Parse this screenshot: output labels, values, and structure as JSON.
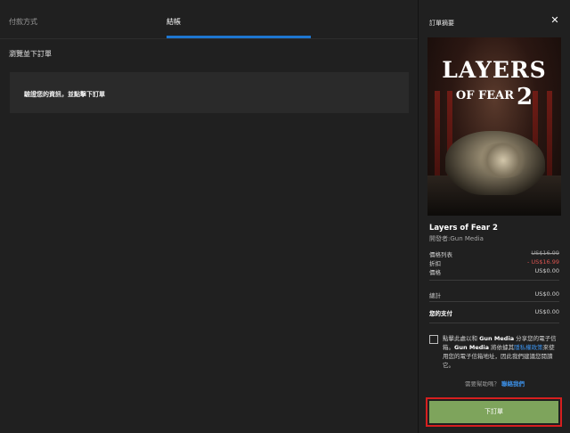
{
  "tabs": [
    {
      "label": "付款方式"
    },
    {
      "label": "結帳"
    }
  ],
  "checkout": {
    "section_title": "瀏覽並下訂單",
    "review_text": "驗證您的資訊，並點擊下訂單"
  },
  "summary": {
    "title": "訂單摘要",
    "close_label": "✕",
    "cover": {
      "logo_line1": "LAYERS",
      "logo_of": "OF",
      "logo_fear": "FEAR",
      "logo_num": "2"
    },
    "game_title": "Layers of Fear 2",
    "publisher": "開發者:Gun Media",
    "price_list_label": "價格列表",
    "price_list_value": "US$16.99",
    "discount_label": "折扣",
    "discount_value": "- US$16.99",
    "price_label": "價格",
    "price_value": "US$0.00",
    "subtotal_label": "總計",
    "subtotal_value": "US$0.00",
    "total_label": "您的支付",
    "total_value": "US$0.00",
    "consent_prefix": "點擊此處以和",
    "consent_brand1": "Gun Media",
    "consent_mid1": "分享您的電子信箱。",
    "consent_brand2": "Gun Media",
    "consent_mid2": "將依據其",
    "consent_link": "隱私權政策",
    "consent_suffix": "來使用您的電子信箱地址，因此我們建議您閱讀它。",
    "help_text": "需要幫助嗎？",
    "help_link": "聯絡我們",
    "place_order": "下訂單"
  },
  "colors": {
    "accent": "#1e76d0",
    "button": "#7ea45c",
    "highlight": "#d61f1f",
    "link": "#3b8fe6"
  }
}
